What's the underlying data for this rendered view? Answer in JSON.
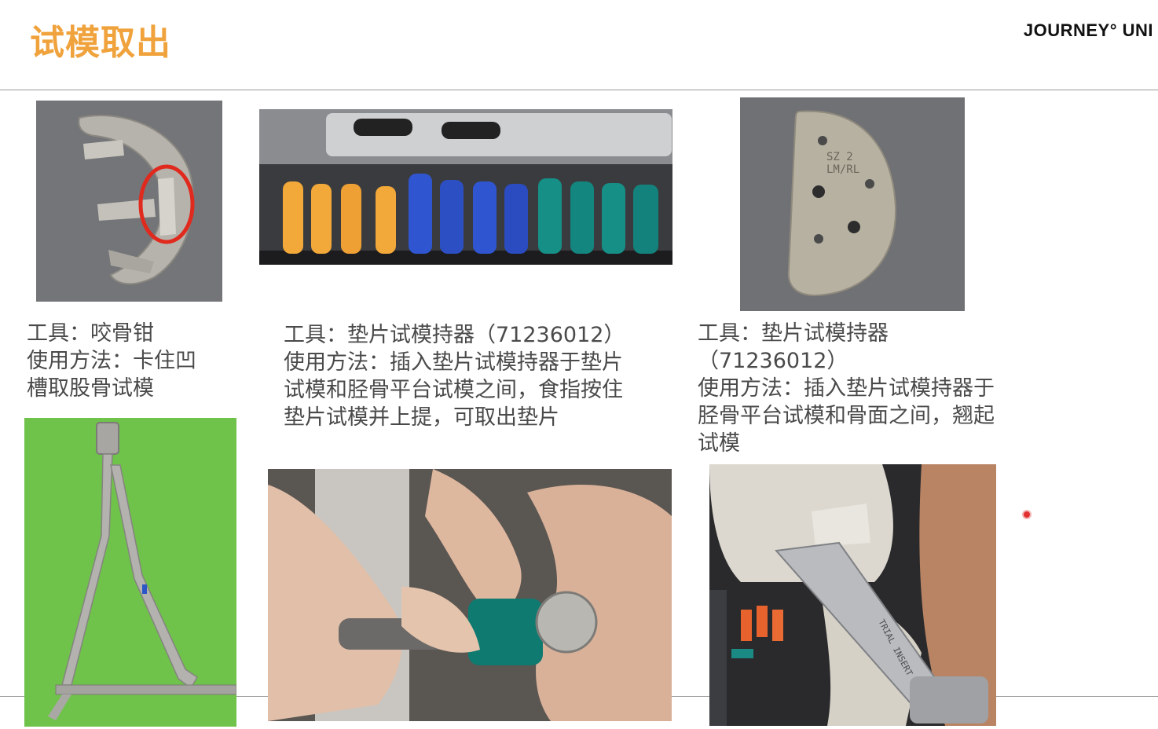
{
  "page": {
    "title": "试模取出",
    "brand": "JOURNEY° UNI"
  },
  "captions": {
    "left": [
      "工具：咬骨钳",
      "使用方法：卡住凹",
      "槽取股骨试模"
    ],
    "middle": [
      "工具：垫片试模持器（71236012）",
      "使用方法：插入垫片试模持器于垫片",
      "试模和胫骨平台试模之间，食指按住",
      "垫片试模并上提，可取出垫片"
    ],
    "right": [
      "工具：垫片试模持器",
      "（71236012）",
      "使用方法：插入垫片试模持器于",
      "胫骨平台试模和骨面之间，翘起",
      "试模"
    ]
  },
  "photo_text": {
    "insert_label_1": "SZ 2",
    "insert_label_2": "LM/RL",
    "handle_label": "TRIAL INSERT HANDLE"
  },
  "colors": {
    "title": "#f0a23c",
    "highlight_circle": "#e02a1e",
    "spacer_orange": "#f2a93a",
    "spacer_blue": "#2f56d0",
    "spacer_teal": "#168f87",
    "green_backdrop": "#6fc24a"
  }
}
